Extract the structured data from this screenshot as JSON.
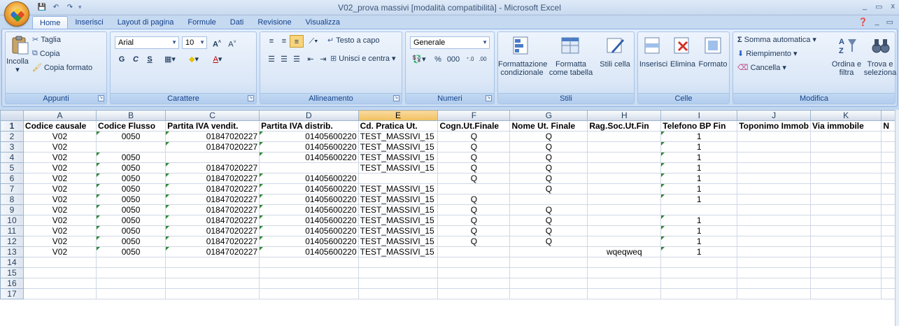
{
  "window": {
    "title": "V02_prova massivi  [modalità compatibilità] - Microsoft Excel",
    "controls": [
      "_",
      "▭",
      "x"
    ]
  },
  "qat": {
    "save": "💾",
    "undo": "↶",
    "redo": "↷"
  },
  "tabs": [
    "Home",
    "Inserisci",
    "Layout di pagina",
    "Formule",
    "Dati",
    "Revisione",
    "Visualizza"
  ],
  "ribbon": {
    "appunti": {
      "label": "Appunti",
      "paste": "Incolla",
      "cut": "Taglia",
      "copy": "Copia",
      "format_painter": "Copia formato"
    },
    "carattere": {
      "label": "Carattere",
      "font": "Arial",
      "size": "10",
      "bold": "G",
      "italic": "C",
      "underline": "S"
    },
    "allineamento": {
      "label": "Allineamento",
      "wrap": "Testo a capo",
      "merge": "Unisci e centra"
    },
    "numeri": {
      "label": "Numeri",
      "format": "Generale",
      "percent": "%",
      "thousands": "000"
    },
    "stili": {
      "label": "Stili",
      "conditional": "Formattazione condizionale",
      "table": "Formatta come tabella",
      "cell_styles": "Stili cella"
    },
    "celle": {
      "label": "Celle",
      "insert": "Inserisci",
      "delete": "Elimina",
      "format": "Formato"
    },
    "modifica": {
      "label": "Modifica",
      "autosum": "Somma automatica",
      "fill": "Riempimento",
      "clear": "Cancella",
      "sort": "Ordina e filtra",
      "find": "Trova e seleziona"
    }
  },
  "sheet": {
    "columns": [
      "A",
      "B",
      "C",
      "D",
      "E",
      "F",
      "G",
      "H",
      "I",
      "J",
      "K",
      "N"
    ],
    "selected_column": "E",
    "rows": [
      {
        "n": "1",
        "cells": [
          "Codice causale",
          "Codice Flusso",
          "Partita IVA vendit.",
          "Partita IVA distrib.",
          "Cd. Pratica Ut.",
          "Cogn.Ut.Finale",
          "Nome Ut. Finale",
          "Rag.Soc.Ut.Fin",
          "Telefono BP Fin",
          "Toponimo Immob",
          "Via immobile",
          "N"
        ]
      },
      {
        "n": "2",
        "cells": [
          "V02",
          "0050",
          "01847020227",
          "01405600220",
          "TEST_MASSIVI_15",
          "Q",
          "Q",
          "",
          "1",
          "",
          "",
          ""
        ]
      },
      {
        "n": "3",
        "cells": [
          "V02",
          "",
          "01847020227",
          "01405600220",
          "TEST_MASSIVI_15",
          "Q",
          "Q",
          "",
          "1",
          "",
          "",
          ""
        ]
      },
      {
        "n": "4",
        "cells": [
          "V02",
          "0050",
          "",
          "01405600220",
          "TEST_MASSIVI_15",
          "Q",
          "Q",
          "",
          "1",
          "",
          "",
          ""
        ]
      },
      {
        "n": "5",
        "cells": [
          "V02",
          "0050",
          "01847020227",
          "",
          "TEST_MASSIVI_15",
          "Q",
          "Q",
          "",
          "1",
          "",
          "",
          ""
        ]
      },
      {
        "n": "6",
        "cells": [
          "V02",
          "0050",
          "01847020227",
          "01405600220",
          "",
          "Q",
          "Q",
          "",
          "1",
          "",
          "",
          ""
        ]
      },
      {
        "n": "7",
        "cells": [
          "V02",
          "0050",
          "01847020227",
          "01405600220",
          "TEST_MASSIVI_15",
          "",
          "Q",
          "",
          "1",
          "",
          "",
          ""
        ]
      },
      {
        "n": "8",
        "cells": [
          "V02",
          "0050",
          "01847020227",
          "01405600220",
          "TEST_MASSIVI_15",
          "Q",
          "",
          "",
          "1",
          "",
          "",
          ""
        ]
      },
      {
        "n": "9",
        "cells": [
          "V02",
          "0050",
          "01847020227",
          "01405600220",
          "TEST_MASSIVI_15",
          "Q",
          "Q",
          "",
          "",
          "",
          "",
          ""
        ]
      },
      {
        "n": "10",
        "cells": [
          "V02",
          "0050",
          "01847020227",
          "01405600220",
          "TEST_MASSIVI_15",
          "Q",
          "Q",
          "",
          "1",
          "",
          "",
          ""
        ]
      },
      {
        "n": "11",
        "cells": [
          "V02",
          "0050",
          "01847020227",
          "01405600220",
          "TEST_MASSIVI_15",
          "Q",
          "Q",
          "",
          "1",
          "",
          "",
          ""
        ]
      },
      {
        "n": "12",
        "cells": [
          "V02",
          "0050",
          "01847020227",
          "01405600220",
          "TEST_MASSIVI_15",
          "Q",
          "Q",
          "",
          "1",
          "",
          "",
          ""
        ]
      },
      {
        "n": "13",
        "cells": [
          "V02",
          "0050",
          "01847020227",
          "01405600220",
          "TEST_MASSIVI_15",
          "",
          "",
          "wqeqweq",
          "1",
          "",
          "",
          ""
        ]
      },
      {
        "n": "14",
        "cells": [
          "",
          "",
          "",
          "",
          "",
          "",
          "",
          "",
          "",
          "",
          "",
          ""
        ]
      },
      {
        "n": "15",
        "cells": [
          "",
          "",
          "",
          "",
          "",
          "",
          "",
          "",
          "",
          "",
          "",
          ""
        ]
      },
      {
        "n": "16",
        "cells": [
          "",
          "",
          "",
          "",
          "",
          "",
          "",
          "",
          "",
          "",
          "",
          ""
        ]
      },
      {
        "n": "17",
        "cells": [
          "",
          "",
          "",
          "",
          "",
          "",
          "",
          "",
          "",
          "",
          "",
          ""
        ]
      }
    ]
  }
}
